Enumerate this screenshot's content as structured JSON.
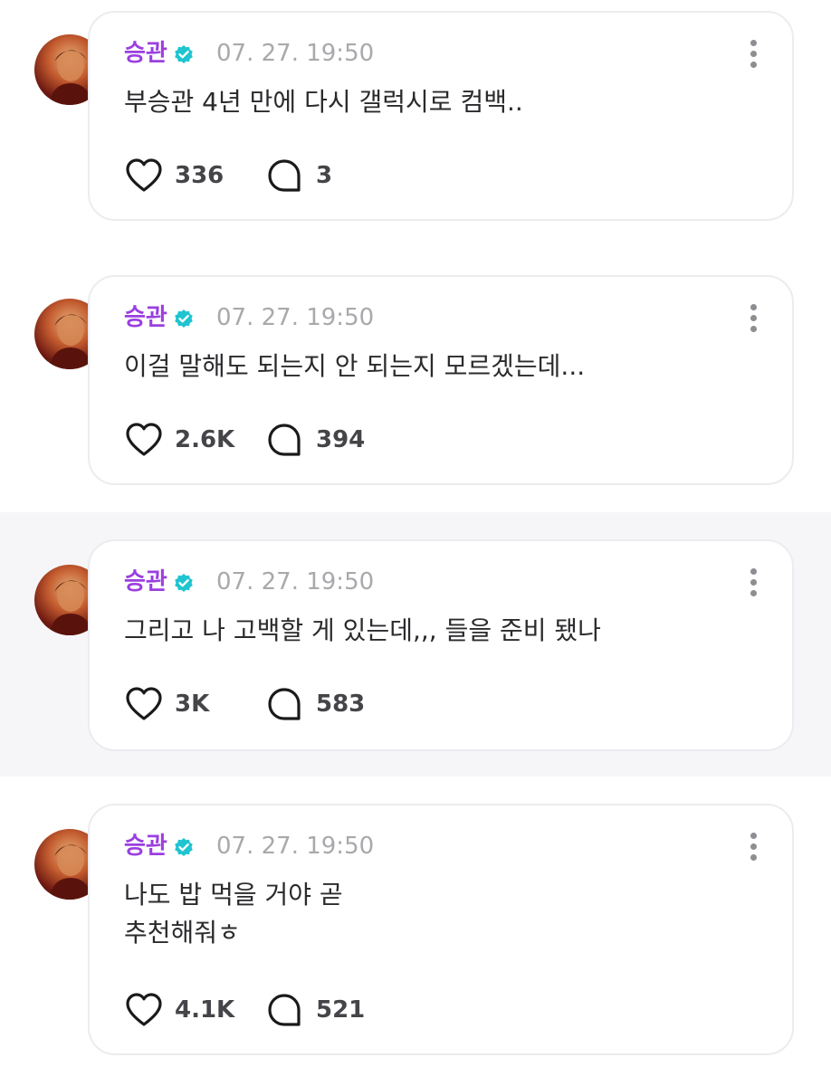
{
  "posts": [
    {
      "author": "승관",
      "timestamp": "07. 27. 19:50",
      "lines": [
        "부승관 4년 만에 다시 갤럭시로 컴백.."
      ],
      "likes": "336",
      "comments": "3"
    },
    {
      "author": "승관",
      "timestamp": "07. 27. 19:50",
      "lines": [
        "이걸 말해도 되는지 안 되는지 모르겠는데..."
      ],
      "likes": "2.6K",
      "comments": "394"
    },
    {
      "author": "승관",
      "timestamp": "07. 27. 19:50",
      "lines": [
        "그리고 나 고백할 게 있는데,,, 들을 준비 됐나"
      ],
      "likes": "3K",
      "comments": "583"
    },
    {
      "author": "승관",
      "timestamp": "07. 27. 19:50",
      "lines": [
        "나도 밥 먹을 거야 곧",
        "추천해줘ㅎ"
      ],
      "likes": "4.1K",
      "comments": "521"
    }
  ],
  "icons": {
    "verified": "verified-badge-icon",
    "more": "more-vertical-icon",
    "like": "heart-icon",
    "comment": "comment-bubble-icon"
  },
  "colors": {
    "author": "#9b3fe0",
    "verified_badge": "#1fc4d0",
    "highlight_background": "#f6f6f8"
  }
}
